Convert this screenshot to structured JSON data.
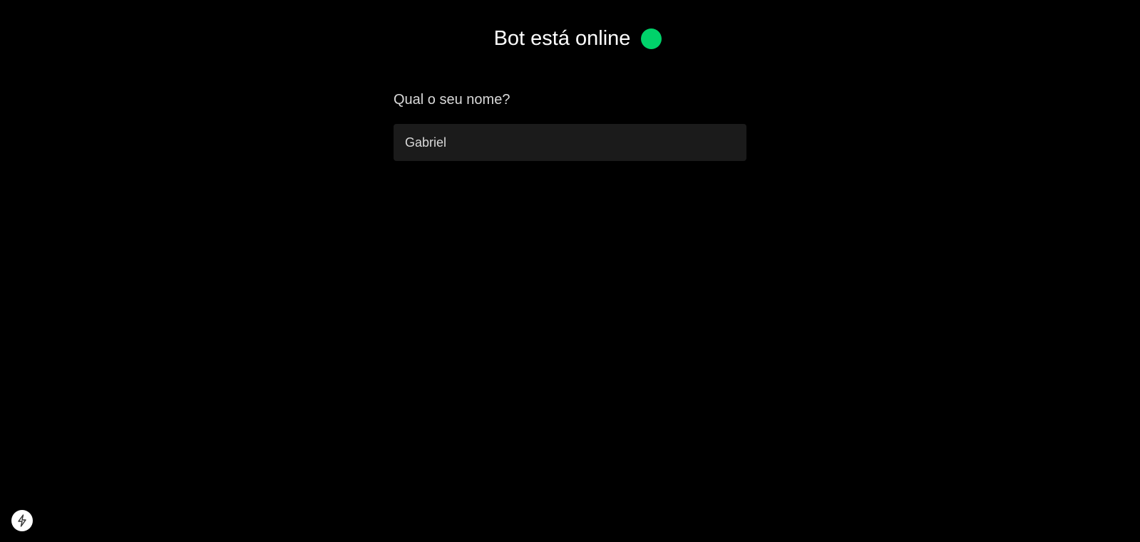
{
  "header": {
    "title": "Bot está online",
    "status_color": "#00d26a"
  },
  "form": {
    "label": "Qual o seu nome?",
    "name_value": "Gabriel"
  },
  "dev_indicator": {
    "icon": "lightning-bolt-icon"
  }
}
